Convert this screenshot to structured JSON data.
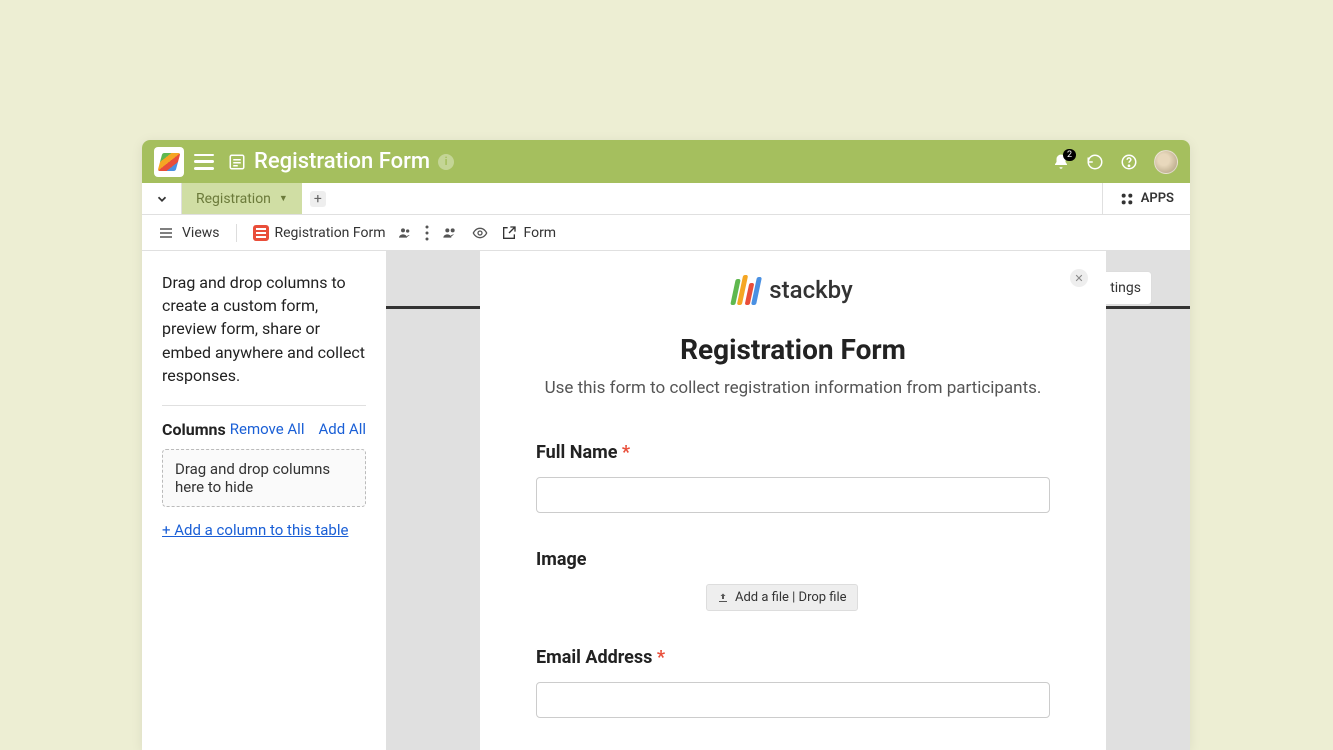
{
  "header": {
    "title": "Registration Form",
    "notification_count": "2"
  },
  "tabs": {
    "active_tab": "Registration",
    "apps_label": "APPS"
  },
  "toolbar": {
    "views_label": "Views",
    "form_name": "Registration Form",
    "form_label": "Form"
  },
  "sidebar": {
    "description": "Drag and drop columns to create a custom form, preview form, share or embed anywhere and collect responses.",
    "columns_label": "Columns",
    "remove_all": "Remove All",
    "add_all": "Add All",
    "dropzone": "Drag and drop columns here to hide",
    "add_column": "+ Add a column to this table"
  },
  "form": {
    "logo_text": "stackby",
    "title": "Registration Form",
    "subtitle": "Use this form to collect registration information from participants.",
    "fields": {
      "full_name": {
        "label": "Full Name"
      },
      "image": {
        "label": "Image",
        "button": "Add a file | Drop file"
      },
      "email": {
        "label": "Email Address"
      }
    }
  },
  "right": {
    "settings_partial": "tings"
  }
}
